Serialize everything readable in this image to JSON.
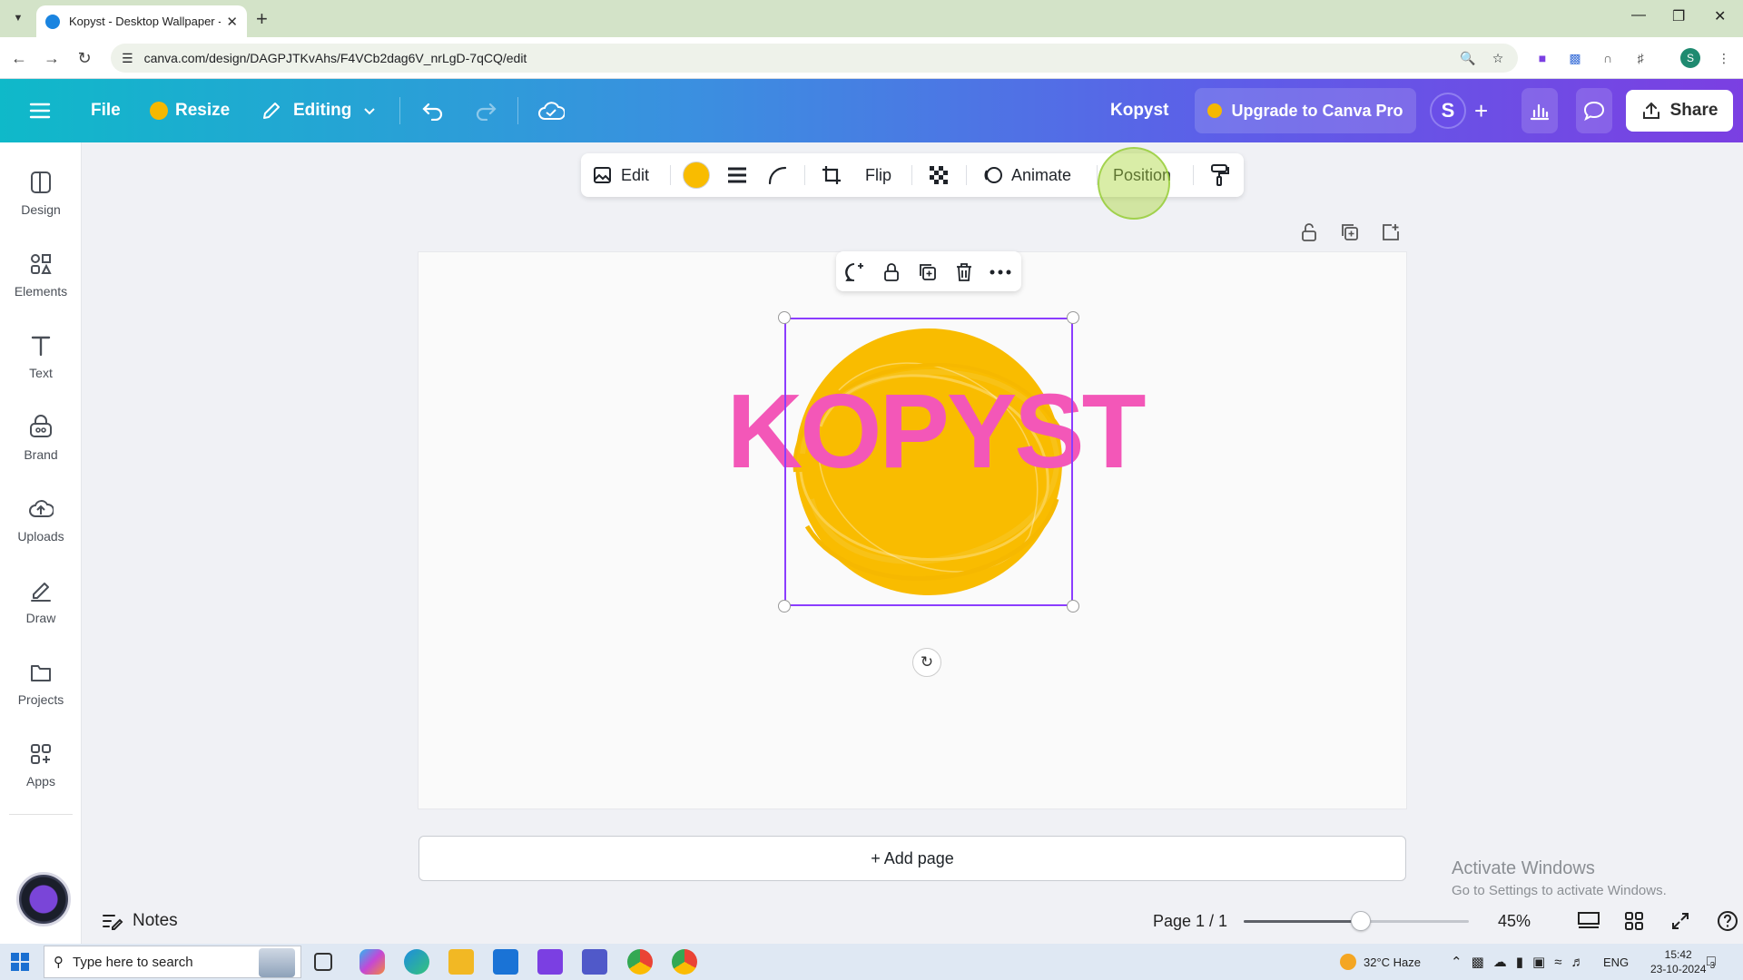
{
  "browser": {
    "tab_title": "Kopyst - Desktop Wallpaper - C",
    "url": "canva.com/design/DAGPJTKvAhs/F4VCb2dag6V_nrLgD-7qCQ/edit",
    "profile_initial": "S"
  },
  "header": {
    "file_label": "File",
    "resize_label": "Resize",
    "editing_label": "Editing",
    "design_name": "Kopyst",
    "upgrade_label": "Upgrade to Canva Pro",
    "avatar_initial": "S",
    "share_label": "Share"
  },
  "sidebar": {
    "items": [
      {
        "label": "Design",
        "icon": "design-icon"
      },
      {
        "label": "Elements",
        "icon": "elements-icon"
      },
      {
        "label": "Text",
        "icon": "text-icon"
      },
      {
        "label": "Brand",
        "icon": "brand-icon"
      },
      {
        "label": "Uploads",
        "icon": "uploads-icon"
      },
      {
        "label": "Draw",
        "icon": "draw-icon"
      },
      {
        "label": "Projects",
        "icon": "projects-icon"
      },
      {
        "label": "Apps",
        "icon": "apps-icon"
      }
    ]
  },
  "toolbar": {
    "edit_label": "Edit",
    "fill_color": "#f9bc00",
    "flip_label": "Flip",
    "animate_label": "Animate",
    "position_label": "Position"
  },
  "canvas": {
    "logo_text": "KOPYST",
    "logo_text_color": "#f357b8",
    "circle_color": "#f9bc00",
    "add_page_label": "+ Add page"
  },
  "watermark": {
    "line1": "Activate Windows",
    "line2": "Go to Settings to activate Windows."
  },
  "bottombar": {
    "notes_label": "Notes",
    "page_info": "Page 1 / 1",
    "zoom_value": 45,
    "zoom_label": "45%"
  },
  "taskbar": {
    "search_placeholder": "Type here to search",
    "weather": "32°C  Haze",
    "language": "ENG",
    "time": "15:42",
    "date": "23-10-2024",
    "notification_count": "3"
  }
}
